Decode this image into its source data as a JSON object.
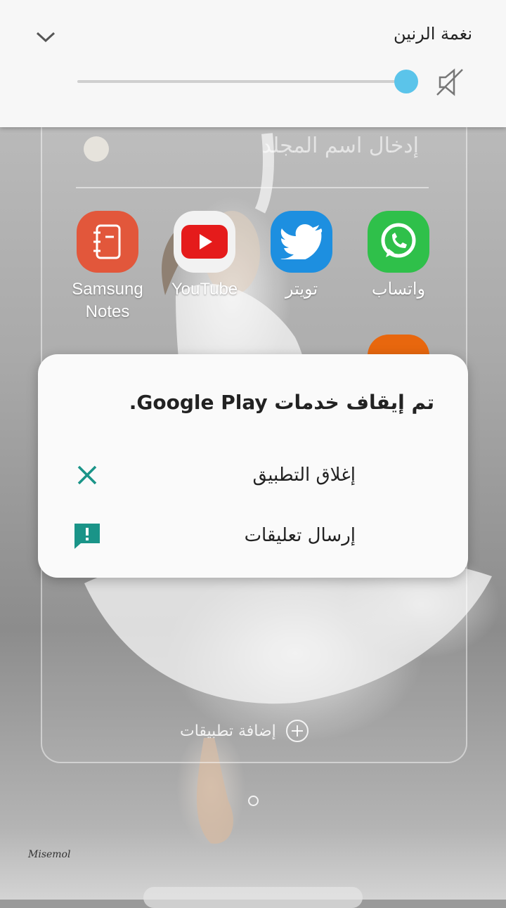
{
  "volume_panel": {
    "title": "نغمة الرنين",
    "level": 0.97,
    "accent_color": "#5bc4ea",
    "collapse_icon": "chevron-down-icon",
    "mute_icon": "ringtone-mute-icon"
  },
  "folder": {
    "name_placeholder": "إدخال اسم المجلد",
    "apps": [
      {
        "label": "واتساب",
        "icon": "whatsapp-icon",
        "color": "#2fc04a"
      },
      {
        "label": "تويتر",
        "icon": "twitter-icon",
        "color": "#1d8fe0"
      },
      {
        "label": "YouTube",
        "icon": "youtube-icon",
        "color": "#e51b1b"
      },
      {
        "label": "Samsung\nNotes",
        "icon": "samsung-notes-icon",
        "color": "#e2573b"
      }
    ],
    "add_apps_label": "إضافة تطبيقات"
  },
  "dialog": {
    "title": "تم إيقاف خدمات Google Play.",
    "options": [
      {
        "label": "إغلاق التطبيق",
        "icon": "close-icon"
      },
      {
        "label": "إرسال تعليقات",
        "icon": "feedback-icon"
      }
    ],
    "icon_color": "#1a9488"
  },
  "wallpaper": {
    "signature": "Misemol"
  }
}
